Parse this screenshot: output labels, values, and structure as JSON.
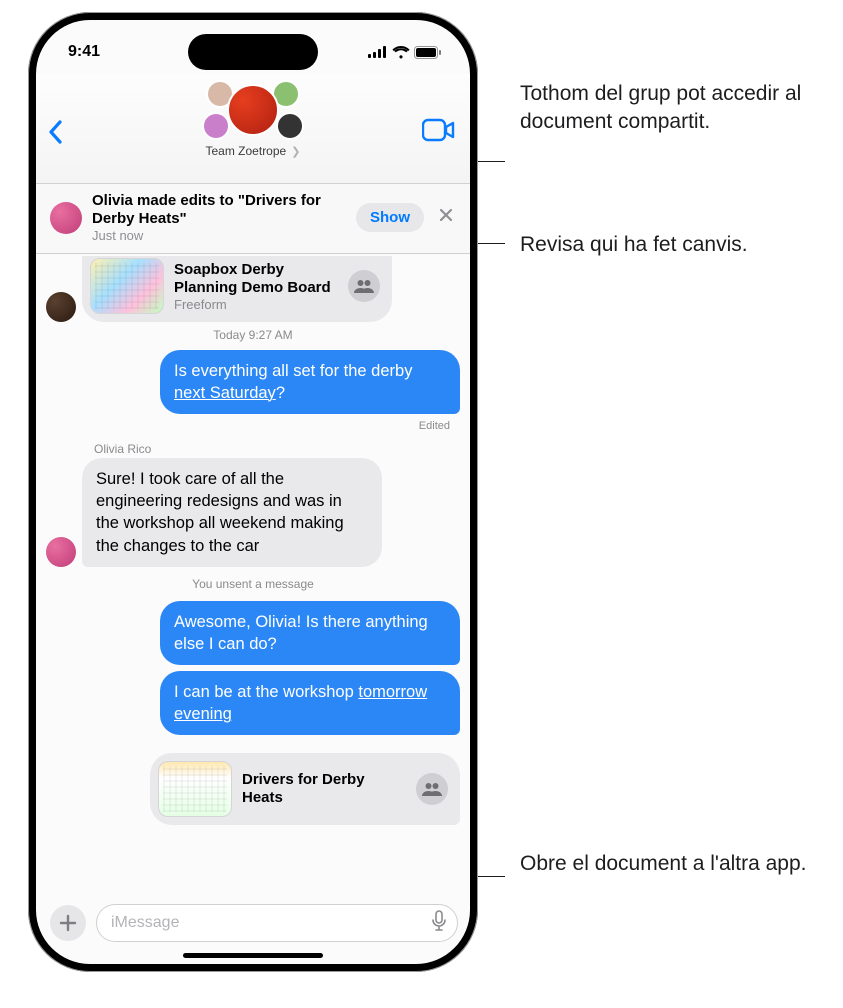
{
  "status": {
    "time": "9:41"
  },
  "header": {
    "chat_title": "Team Zoetrope"
  },
  "banner": {
    "title": "Olivia made edits to \"Drivers for Derby Heats\"",
    "time": "Just now",
    "show_label": "Show"
  },
  "cards": {
    "planning": {
      "title": "Soapbox Derby Planning Demo Board",
      "source": "Freeform"
    },
    "drivers": {
      "title": "Drivers for Derby Heats"
    }
  },
  "timeline": {
    "today_label": "Today 9:27 AM"
  },
  "messages": {
    "m1_pre": "Is everything all set for the derby ",
    "m1_link": "next Saturday",
    "m1_post": "?",
    "edited_label": "Edited",
    "olivia_name": "Olivia Rico",
    "m2": "Sure! I took care of all the engineering redesigns and was in the workshop all weekend making the changes to the car",
    "unsent_note": "You unsent a message",
    "m3": "Awesome, Olivia! Is there anything else I can do?",
    "m4_pre": "I can be at the workshop ",
    "m4_link": "tomorrow evening"
  },
  "compose": {
    "placeholder": "iMessage"
  },
  "callouts": {
    "c1": "Tothom del grup pot accedir al document compartit.",
    "c2": "Revisa qui ha fet canvis.",
    "c3": "Obre el document a l'altra app."
  }
}
